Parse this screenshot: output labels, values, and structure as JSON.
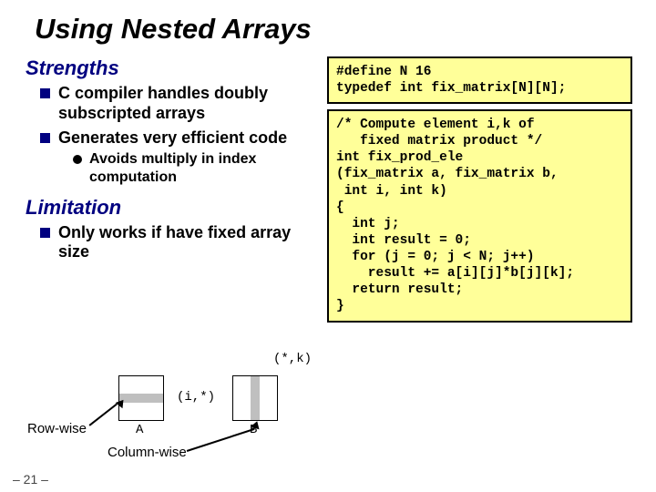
{
  "title": "Using Nested Arrays",
  "sections": {
    "strengths": {
      "head": "Strengths",
      "b1": "C compiler handles doubly subscripted arrays",
      "b2": "Generates very efficient code",
      "b2s1": "Avoids multiply in index computation"
    },
    "limitation": {
      "head": "Limitation",
      "b1": "Only works if have fixed array size"
    }
  },
  "code": {
    "top": "#define N 16\ntypedef int fix_matrix[N][N];",
    "main": "/* Compute element i,k of\n   fixed matrix product */\nint fix_prod_ele\n(fix_matrix a, fix_matrix b,\n int i, int k)\n{\n  int j;\n  int result = 0;\n  for (j = 0; j < N; j++)\n    result += a[i][j]*b[j][k];\n  return result;\n}"
  },
  "fig": {
    "starK": "(*,k)",
    "iStar": "(i,*)",
    "A": "A",
    "B": "B",
    "row": "Row-wise",
    "col": "Column-wise"
  },
  "pagefoot": "– 21 –"
}
